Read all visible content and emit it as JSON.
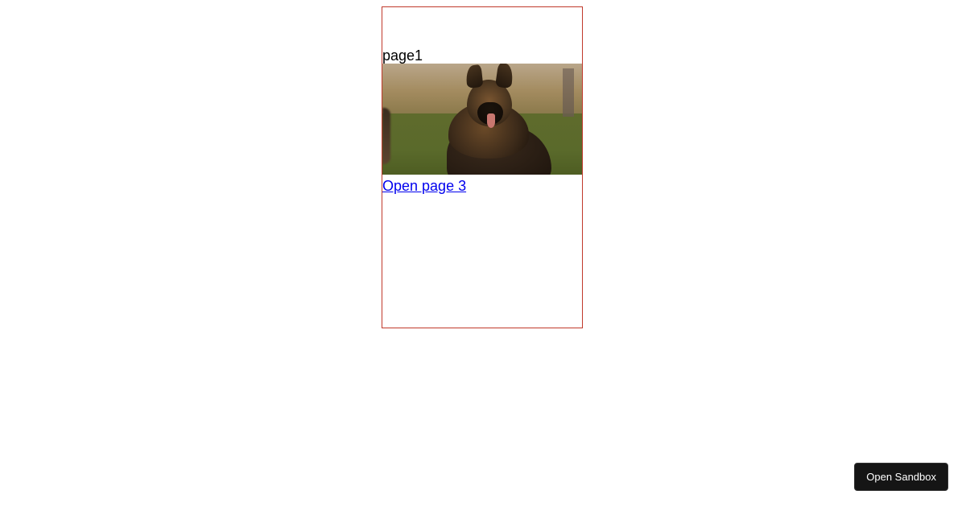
{
  "page": {
    "label": "page1",
    "image_alt": "dog-photo"
  },
  "link": {
    "text": "Open page 3"
  },
  "sandbox": {
    "button_label": "Open Sandbox"
  }
}
